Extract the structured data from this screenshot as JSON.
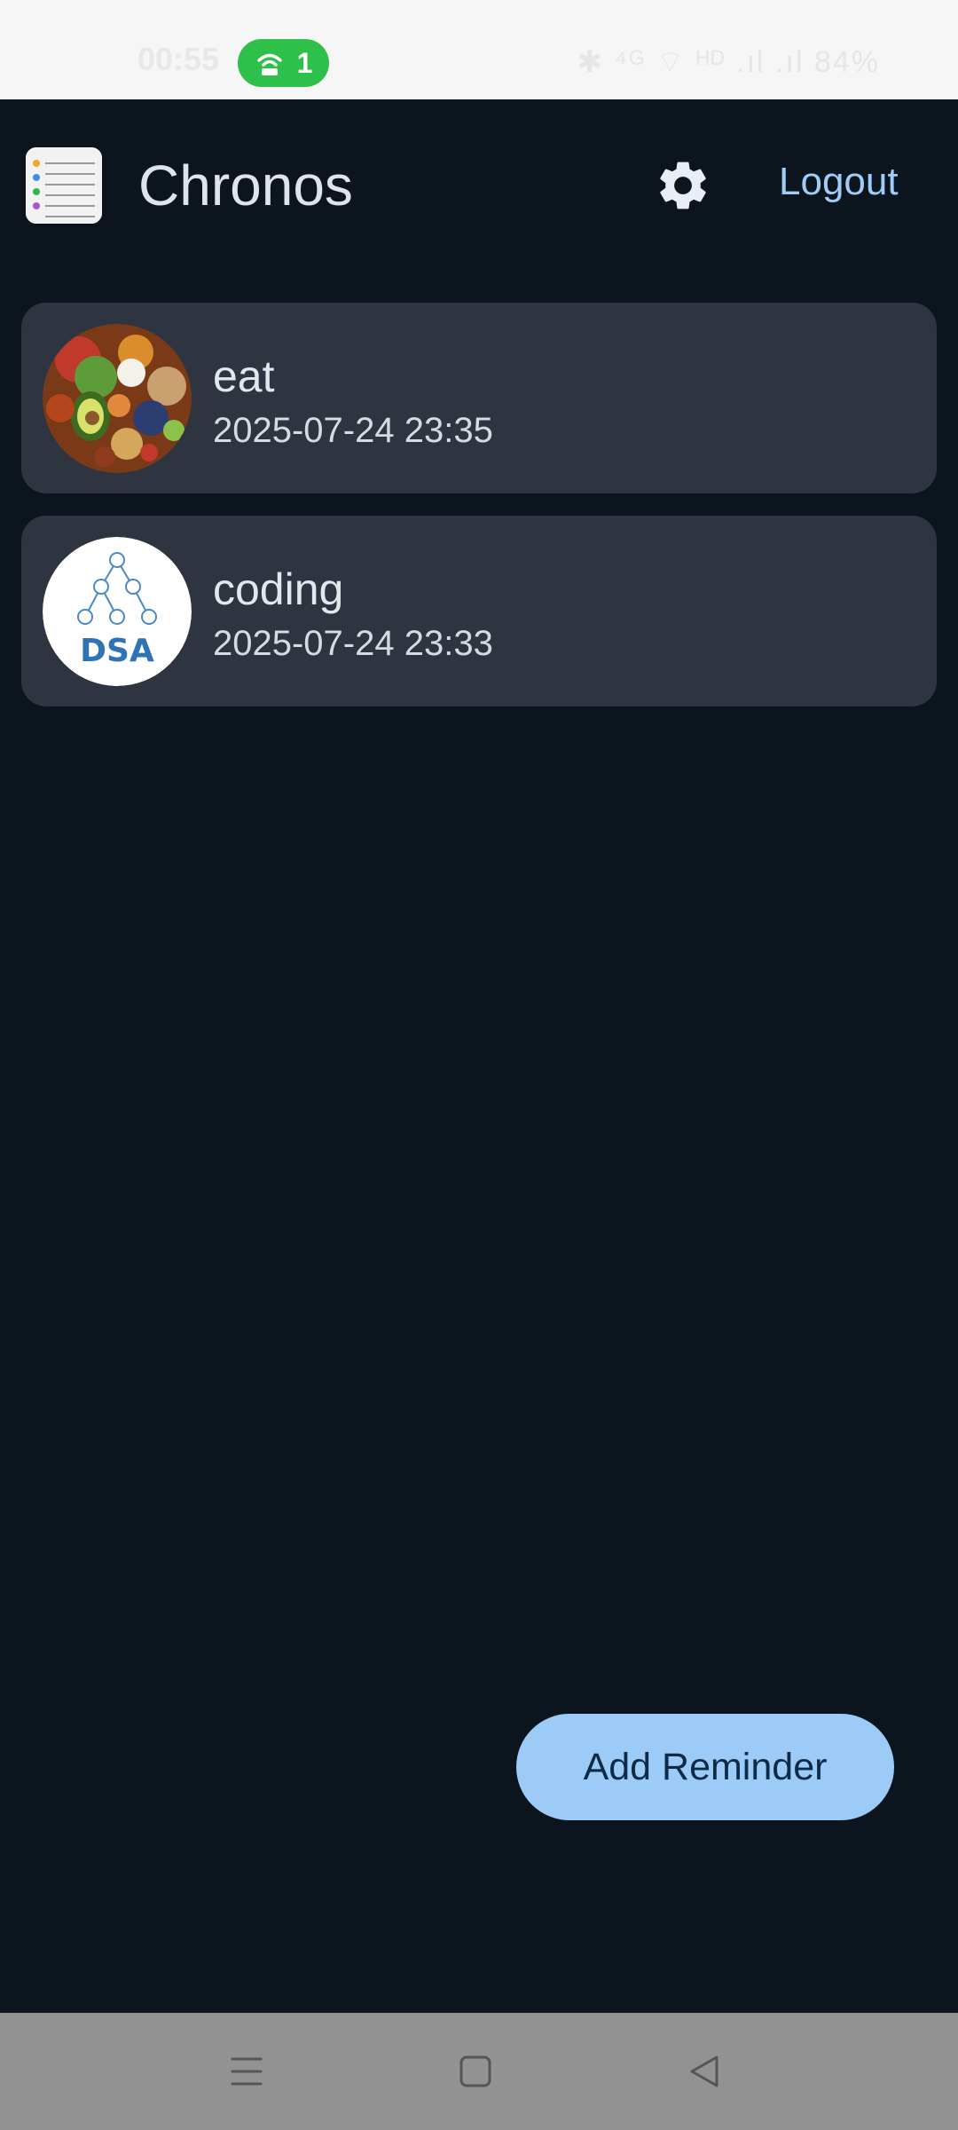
{
  "status_bar": {
    "time": "00:55",
    "hotspot_count": "1",
    "right_text": "✱ ⁴ᴳ ⌔ ᴴᴰ .ıl .ıl 84%"
  },
  "header": {
    "app_title": "Chronos",
    "logout_label": "Logout",
    "settings_icon": "gear-icon",
    "app_icon": "notepad-icon"
  },
  "reminders": [
    {
      "title": "eat",
      "datetime": "2025-07-24 23:35",
      "image": "food-image"
    },
    {
      "title": "coding",
      "datetime": "2025-07-24 23:33",
      "image": "dsa-logo",
      "image_text": "DSA"
    }
  ],
  "fab": {
    "label": "Add Reminder"
  },
  "nav": {
    "menu_icon": "menu-icon",
    "home_icon": "home-square-icon",
    "back_icon": "back-triangle-icon"
  },
  "colors": {
    "background": "#0c141e",
    "card": "#2e3540",
    "accent": "#9ccbf8",
    "logout": "#9fcdf7"
  }
}
